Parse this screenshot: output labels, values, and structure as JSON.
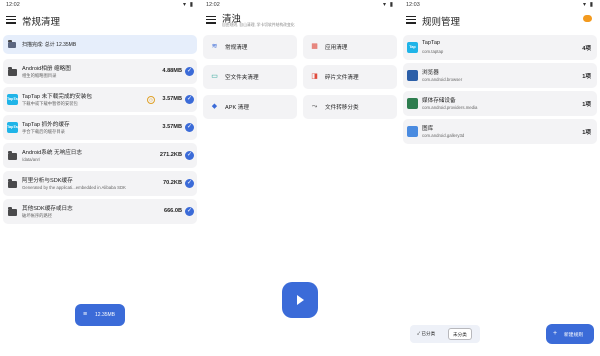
{
  "screen1": {
    "status": {
      "time": "12:02",
      "icons": "▾ ▮"
    },
    "title": "常规清理",
    "scan_summary": "扫描完成: 总计 12.35MB",
    "items": [
      {
        "title": "Android相册 缩略图",
        "desc": "相生的缩略图目录",
        "size": "4.88MB",
        "icon": "folder-icon"
      },
      {
        "title": "TapTap 未下载完成的安装包",
        "desc": "下载中或下载中暂停的安装包",
        "size": "3.57MB",
        "icon": "taptap-icon",
        "app_label": "TapTap",
        "warn": true
      },
      {
        "title": "TapTap 抓外的缓存",
        "desc": "手合下载后的缓存目录",
        "size": "3.57MB",
        "icon": "taptap-icon",
        "app_label": "TapTap"
      },
      {
        "title": "Android系统 无响应日志",
        "desc": "/data/anr/",
        "size": "271.2KB",
        "icon": "folder-icon"
      },
      {
        "title": "阿里分析与SDK缓存",
        "desc": "Generated by the applicati...embedded in Alibaba SDK",
        "size": "70.2KB",
        "icon": "folder-icon"
      },
      {
        "title": "其他SDK缓存或日志",
        "desc": "破坏帐序的路径",
        "size": "666.0B",
        "icon": "folder-icon"
      }
    ],
    "fab_label": "12.35MB"
  },
  "screen2": {
    "status": {
      "time": "12:02",
      "icons": "▾ ▮"
    },
    "title": "清浊",
    "subtitle": "自由规则, 自山清理, 学卡切软件结构改变化",
    "buttons": [
      {
        "label": "常规清理",
        "icon": "≋",
        "color": "#3b6bd8"
      },
      {
        "label": "应用清理",
        "icon": "▦",
        "color": "#e04a3c"
      },
      {
        "label": "空文件夹清理",
        "icon": "▭",
        "color": "#1a9e8f"
      },
      {
        "label": "碎片文件清理",
        "icon": "◨",
        "color": "#e04a3c"
      },
      {
        "label": "APK 清理",
        "icon": "◆",
        "color": "#3b6bd8"
      },
      {
        "label": "文件转移分类",
        "icon": "⤳",
        "color": "#555555"
      }
    ]
  },
  "screen3": {
    "status": {
      "time": "12:03",
      "icons": "▾ ▮"
    },
    "title": "规则管理",
    "rules": [
      {
        "title": "TapTap",
        "pkg": "com.taptap",
        "count": "4项",
        "icon": "taptap-icon",
        "color": "#1fb4e8",
        "app_label": "Tap"
      },
      {
        "title": "浏览器",
        "pkg": "com.android.browser",
        "count": "1项",
        "icon": "browser-icon",
        "color": "#2c5fa8"
      },
      {
        "title": "媒体存储设备",
        "pkg": "com.android.providers.media",
        "count": "1项",
        "icon": "media-icon",
        "color": "#2e7d4f"
      },
      {
        "title": "图库",
        "pkg": "com.android.gallery3d",
        "count": "1项",
        "icon": "gallery-icon",
        "color": "#4a8be0"
      }
    ],
    "filter": {
      "classified": "已分类",
      "unclassified": "未分类"
    },
    "fab_label": "新建规则"
  }
}
